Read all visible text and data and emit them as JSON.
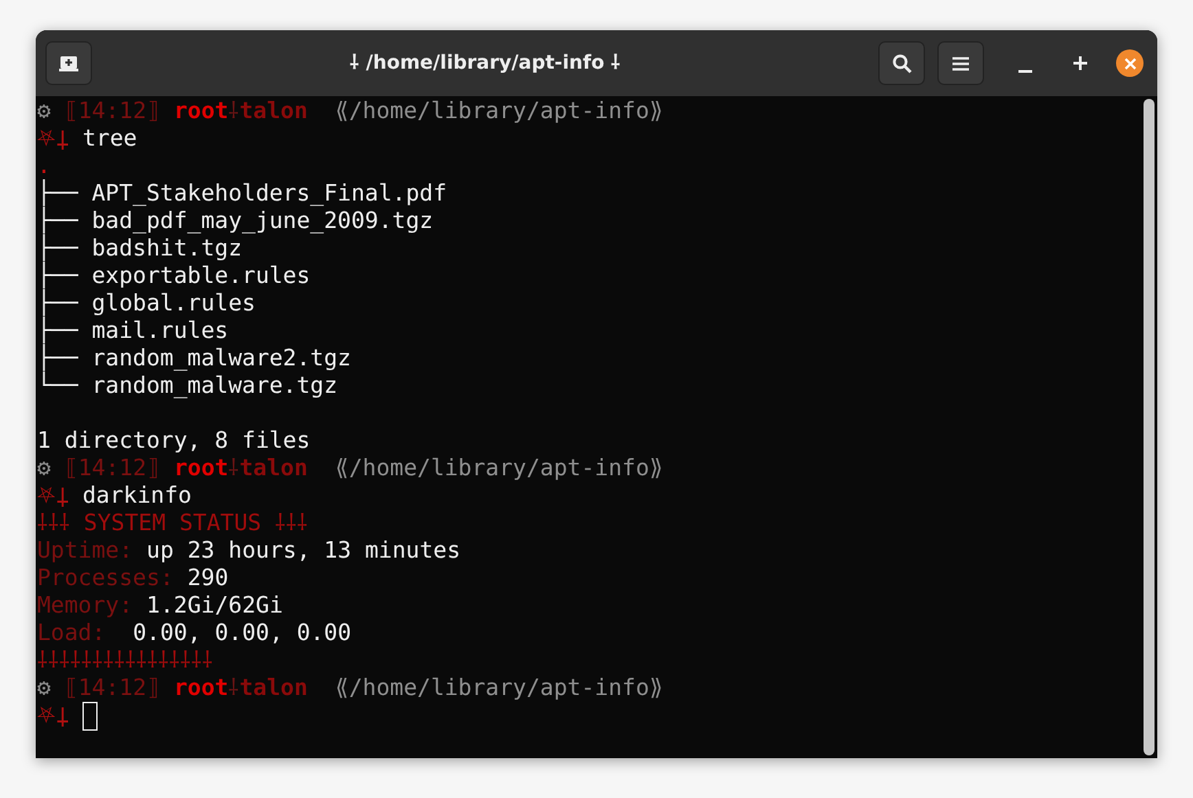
{
  "window": {
    "title": "⸸ /home/library/apt-info ⸸"
  },
  "terminal": {
    "lines": [
      [
        {
          "kind": "gear",
          "text": "⚙"
        },
        {
          "kind": "time",
          "text": "⟦14:12⟧"
        },
        {
          "kind": "user",
          "text": "root"
        },
        {
          "kind": "sep",
          "text": "⸸"
        },
        {
          "kind": "host",
          "text": "talon"
        },
        {
          "kind": "path",
          "text": "⟪/home/library/apt-info⟫"
        }
      ],
      [
        {
          "kind": "prompt",
          "text": "⛧⸸"
        },
        {
          "kind": "cmd",
          "text": "tree"
        }
      ],
      [
        {
          "kind": "dot",
          "text": "."
        }
      ],
      [
        {
          "kind": "tree",
          "text": "├── APT_Stakeholders_Final.pdf"
        }
      ],
      [
        {
          "kind": "tree",
          "text": "├── bad_pdf_may_june_2009.tgz"
        }
      ],
      [
        {
          "kind": "tree",
          "text": "├── badshit.tgz"
        }
      ],
      [
        {
          "kind": "tree",
          "text": "├── exportable.rules"
        }
      ],
      [
        {
          "kind": "tree",
          "text": "├── global.rules"
        }
      ],
      [
        {
          "kind": "tree",
          "text": "├── mail.rules"
        }
      ],
      [
        {
          "kind": "tree",
          "text": "├── random_malware2.tgz"
        }
      ],
      [
        {
          "kind": "tree",
          "text": "└── random_malware.tgz"
        }
      ],
      {
        "blank_before": true,
        "segments": [
          {
            "kind": "output",
            "text": "1 directory, 8 files"
          }
        ]
      },
      [
        {
          "kind": "gear",
          "text": "⚙"
        },
        {
          "kind": "time",
          "text": "⟦14:12⟧"
        },
        {
          "kind": "user",
          "text": "root"
        },
        {
          "kind": "sep",
          "text": "⸸"
        },
        {
          "kind": "host",
          "text": "talon"
        },
        {
          "kind": "path",
          "text": "⟪/home/library/apt-info⟫"
        }
      ],
      [
        {
          "kind": "prompt",
          "text": "⛧⸸"
        },
        {
          "kind": "cmd",
          "text": "darkinfo"
        }
      ],
      [
        {
          "kind": "heading",
          "text": "⸸⸸⸸ SYSTEM STATUS ⸸⸸⸸"
        }
      ],
      [
        {
          "kind": "label",
          "text": "Uptime:"
        },
        {
          "kind": "output",
          "text": "up 23 hours, 13 minutes"
        }
      ],
      [
        {
          "kind": "label",
          "text": "Processes:"
        },
        {
          "kind": "output",
          "text": "290"
        }
      ],
      [
        {
          "kind": "label",
          "text": "Memory:"
        },
        {
          "kind": "output",
          "text": "1.2Gi/62Gi"
        }
      ],
      [
        {
          "kind": "label",
          "text": "Load: "
        },
        {
          "kind": "output",
          "text": "0.00, 0.00, 0.00"
        }
      ],
      [
        {
          "kind": "heading",
          "text": "⸸⸸⸸⸸⸸⸸⸸⸸⸸⸸⸸⸸⸸⸸⸸⸸"
        }
      ],
      [
        {
          "kind": "gear",
          "text": "⚙"
        },
        {
          "kind": "time",
          "text": "⟦14:12⟧"
        },
        {
          "kind": "user",
          "text": "root"
        },
        {
          "kind": "sep",
          "text": "⸸"
        },
        {
          "kind": "host",
          "text": "talon"
        },
        {
          "kind": "path",
          "text": "⟪/home/library/apt-info⟫"
        }
      ],
      [
        {
          "kind": "prompt",
          "text": "⛧⸸"
        },
        {
          "kind": "cursor"
        }
      ]
    ]
  }
}
